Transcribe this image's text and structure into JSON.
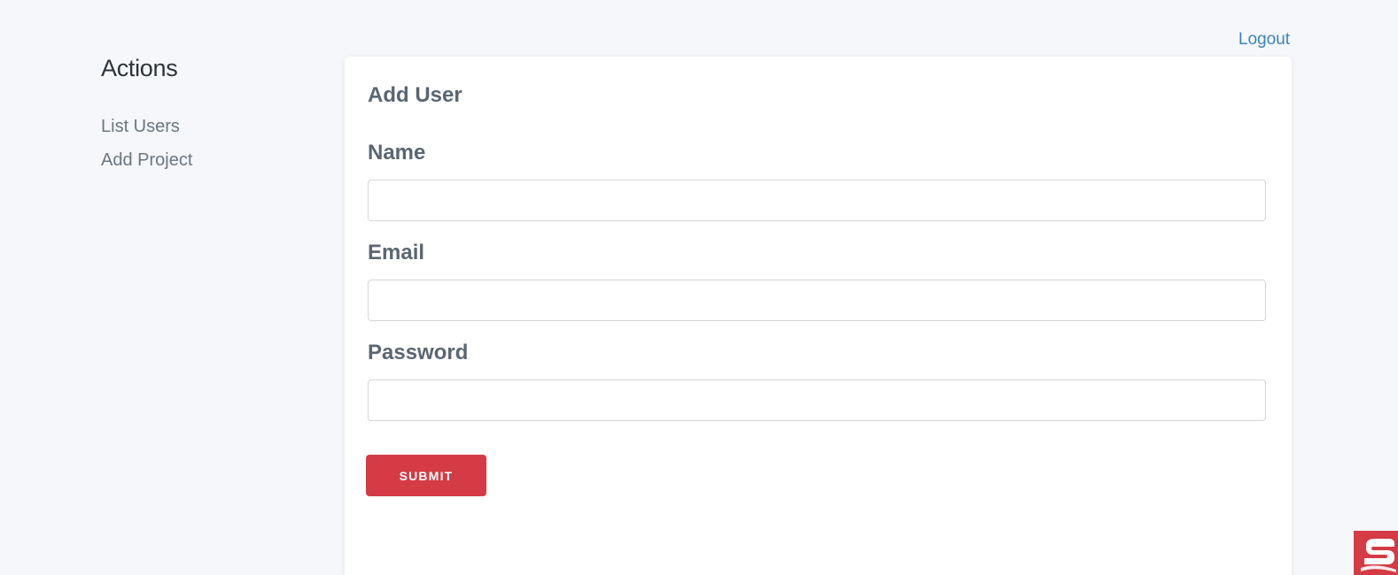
{
  "header": {
    "logout_label": "Logout"
  },
  "sidebar": {
    "title": "Actions",
    "items": [
      {
        "label": "List Users"
      },
      {
        "label": "Add Project"
      }
    ]
  },
  "form": {
    "title": "Add User",
    "fields": [
      {
        "label": "Name",
        "value": "",
        "placeholder": ""
      },
      {
        "label": "Email",
        "value": "",
        "placeholder": ""
      },
      {
        "label": "Password",
        "value": "",
        "placeholder": ""
      }
    ],
    "submit_label": "SUBMIT"
  },
  "colors": {
    "accent": "#d43b45",
    "link": "#3a86b4",
    "background": "#f5f7fa"
  },
  "icons": {
    "corner_badge": "app-logo-icon"
  }
}
